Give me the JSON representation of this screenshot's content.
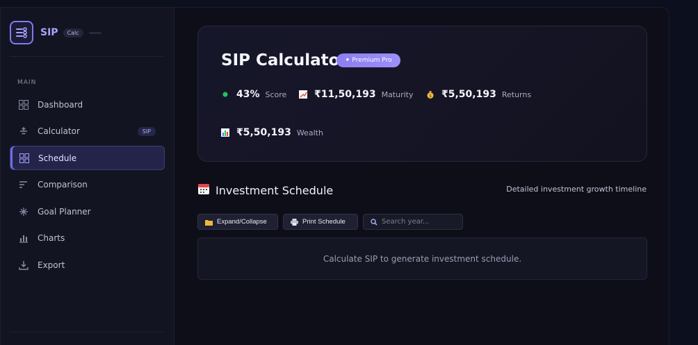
{
  "brand": {
    "name": "SIP",
    "badge": "Calc"
  },
  "sidebar": {
    "section_label": "MAIN",
    "items": [
      {
        "label": "Dashboard",
        "icon": "grid-icon",
        "active": false
      },
      {
        "label": "Calculator",
        "icon": "plus-minus-icon",
        "active": false,
        "badge": "SIP"
      },
      {
        "label": "Schedule",
        "icon": "grid-icon",
        "active": true
      },
      {
        "label": "Comparison",
        "icon": "bars-icon",
        "active": false
      },
      {
        "label": "Goal Planner",
        "icon": "sparkle-icon",
        "active": false
      },
      {
        "label": "Charts",
        "icon": "chart-icon",
        "active": false
      },
      {
        "label": "Export",
        "icon": "download-icon",
        "active": false
      }
    ]
  },
  "hero": {
    "title": "SIP Calculator",
    "premium_badge": "✦ Premium Pro",
    "stats": [
      {
        "value": "43%",
        "label": "Score",
        "icon": "green-dot-icon"
      },
      {
        "value": "₹11,50,193",
        "label": "Maturity",
        "icon": "chart-up-icon"
      },
      {
        "value": "₹5,50,193",
        "label": "Returns",
        "icon": "money-bag-icon"
      },
      {
        "value": "₹5,50,193",
        "label": "Wealth",
        "icon": "bar-chart-icon"
      }
    ]
  },
  "schedule": {
    "title": "Investment Schedule",
    "subtitle": "Detailed investment growth timeline",
    "expand_label": "Expand/Collapse",
    "print_label": "Print Schedule",
    "search_placeholder": "Search year...",
    "empty_message": "Calculate SIP to generate investment schedule."
  },
  "colors": {
    "accent": "#7f7cf0",
    "premium": "#8c7ef2",
    "score_dot": "#22c55e",
    "background": "#0e0e19"
  }
}
